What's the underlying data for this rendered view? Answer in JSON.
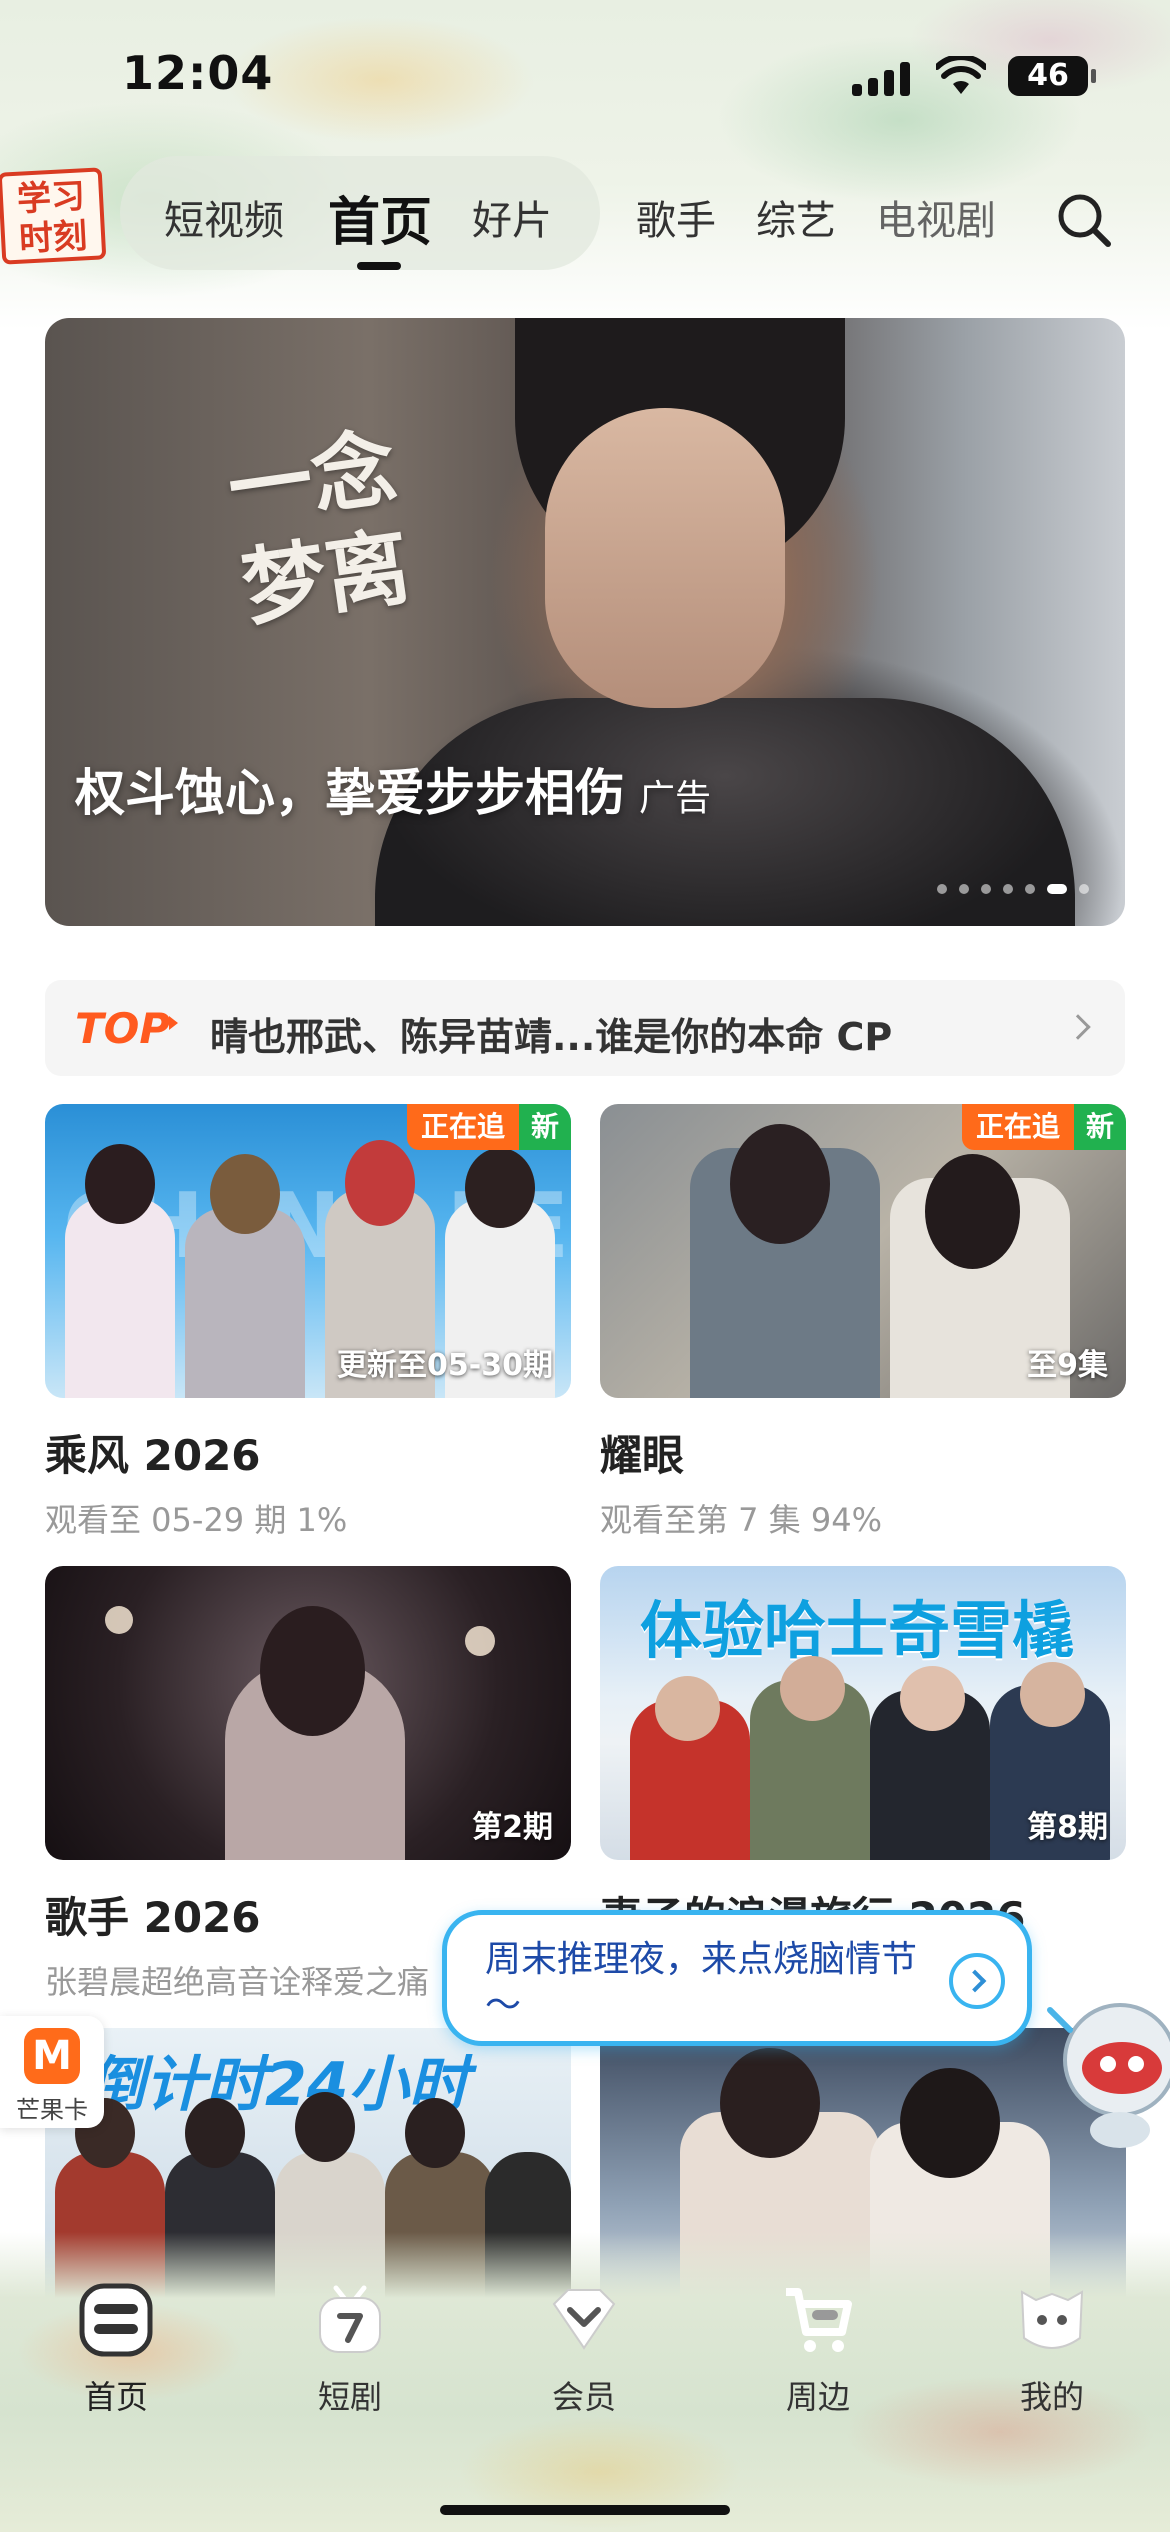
{
  "status_bar": {
    "time": "12:04",
    "battery": "46"
  },
  "header": {
    "logo_text": "学习时刻",
    "tabs": [
      {
        "label": "短视频",
        "active": false
      },
      {
        "label": "首页",
        "active": true
      },
      {
        "label": "好片",
        "active": false
      },
      {
        "label": "歌手",
        "active": false
      },
      {
        "label": "综艺",
        "active": false
      },
      {
        "label": "电视剧",
        "active": false
      }
    ],
    "search_icon": "search-icon"
  },
  "banner": {
    "calligraphy": "一念梦离",
    "caption": "权斗蚀心，挚爱步步相伤",
    "ad_tag": "广告",
    "dots": 7,
    "active_dot": 6
  },
  "top_row": {
    "label": "TOP",
    "text": "晴也邢武、陈异苗靖...谁是你的本命 CP"
  },
  "cards": [
    {
      "title": "乘风 2026",
      "subtitle": "观看至 05-29 期 1%",
      "overlay": "更新至05-30期",
      "badge_follow": "正在追",
      "badge_new": "新"
    },
    {
      "title": "耀眼",
      "subtitle": "观看至第 7 集 94%",
      "overlay": "至9集",
      "badge_follow": "正在追",
      "badge_new": "新"
    },
    {
      "title": "歌手 2026",
      "subtitle": "张碧晨超绝高音诠释爱之痛",
      "overlay": "第2期"
    },
    {
      "title": "妻子的浪漫旅行 2026",
      "subtitle": "",
      "overlay": "第8期",
      "thumb_text": "体验哈士奇雪橇"
    },
    {
      "title": "",
      "subtitle": "",
      "thumb_text": "倒计时24小时"
    },
    {
      "title": "",
      "subtitle": ""
    }
  ],
  "bubble": {
    "text": "周末推理夜，来点烧脑情节～"
  },
  "mango_card": {
    "label": "芒果卡"
  },
  "bottom_nav": [
    {
      "label": "首页",
      "icon": "home-icon"
    },
    {
      "label": "短剧",
      "icon": "short-drama-icon"
    },
    {
      "label": "会员",
      "icon": "vip-icon"
    },
    {
      "label": "周边",
      "icon": "cart-icon"
    },
    {
      "label": "我的",
      "icon": "profile-icon"
    }
  ],
  "colors": {
    "accent_orange": "#ff5a1f",
    "badge_green": "#21b14f",
    "bubble_blue": "#39b4f0"
  }
}
